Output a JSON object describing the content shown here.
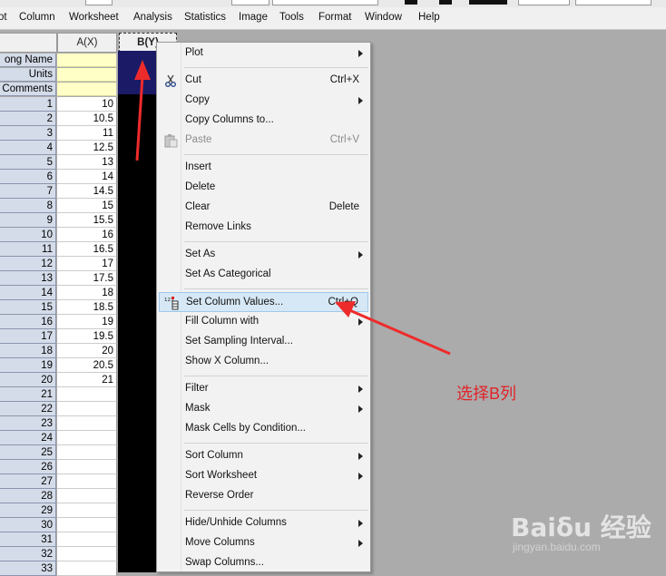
{
  "menubar": {
    "items": [
      "ot",
      "Column",
      "Worksheet",
      "Analysis",
      "Statistics",
      "Image",
      "Tools",
      "Format",
      "Window",
      "Help"
    ]
  },
  "sheet": {
    "col_a_header": "A(X)",
    "col_b_header": "B(Y)",
    "meta_labels": [
      "ong Name",
      "Units",
      "Comments"
    ],
    "rows": [
      {
        "n": "1",
        "a": "10"
      },
      {
        "n": "2",
        "a": "10.5"
      },
      {
        "n": "3",
        "a": "11"
      },
      {
        "n": "4",
        "a": "12.5"
      },
      {
        "n": "5",
        "a": "13"
      },
      {
        "n": "6",
        "a": "14"
      },
      {
        "n": "7",
        "a": "14.5"
      },
      {
        "n": "8",
        "a": "15"
      },
      {
        "n": "9",
        "a": "15.5"
      },
      {
        "n": "10",
        "a": "16"
      },
      {
        "n": "11",
        "a": "16.5"
      },
      {
        "n": "12",
        "a": "17"
      },
      {
        "n": "13",
        "a": "17.5"
      },
      {
        "n": "14",
        "a": "18"
      },
      {
        "n": "15",
        "a": "18.5"
      },
      {
        "n": "16",
        "a": "19"
      },
      {
        "n": "17",
        "a": "19.5"
      },
      {
        "n": "18",
        "a": "20"
      },
      {
        "n": "19",
        "a": "20.5"
      },
      {
        "n": "20",
        "a": "21"
      },
      {
        "n": "21",
        "a": ""
      },
      {
        "n": "22",
        "a": ""
      },
      {
        "n": "23",
        "a": ""
      },
      {
        "n": "24",
        "a": ""
      },
      {
        "n": "25",
        "a": ""
      },
      {
        "n": "26",
        "a": ""
      },
      {
        "n": "27",
        "a": ""
      },
      {
        "n": "28",
        "a": ""
      },
      {
        "n": "29",
        "a": ""
      },
      {
        "n": "30",
        "a": ""
      },
      {
        "n": "31",
        "a": ""
      },
      {
        "n": "32",
        "a": ""
      },
      {
        "n": "33",
        "a": ""
      }
    ]
  },
  "context_menu": {
    "groups": [
      [
        {
          "label": "Plot",
          "shortcut": "",
          "submenu": true
        }
      ],
      [
        {
          "label": "Cut",
          "shortcut": "Ctrl+X",
          "icon": "scissors-icon"
        },
        {
          "label": "Copy",
          "shortcut": "",
          "submenu": true
        },
        {
          "label": "Copy Columns to...",
          "shortcut": ""
        },
        {
          "label": "Paste",
          "shortcut": "Ctrl+V",
          "icon": "clipboard-icon",
          "disabled": true
        }
      ],
      [
        {
          "label": "Insert",
          "shortcut": ""
        },
        {
          "label": "Delete",
          "shortcut": ""
        },
        {
          "label": "Clear",
          "shortcut": "Delete"
        },
        {
          "label": "Remove Links",
          "shortcut": ""
        }
      ],
      [
        {
          "label": "Set As",
          "shortcut": "",
          "submenu": true
        },
        {
          "label": "Set As Categorical",
          "shortcut": ""
        }
      ],
      [
        {
          "label": "Set Column Values...",
          "shortcut": "Ctrl+Q",
          "icon": "set-values-icon",
          "highlighted": true
        },
        {
          "label": "Fill Column with",
          "shortcut": "",
          "submenu": true
        },
        {
          "label": "Set Sampling Interval...",
          "shortcut": ""
        },
        {
          "label": "Show X Column...",
          "shortcut": ""
        }
      ],
      [
        {
          "label": "Filter",
          "shortcut": "",
          "submenu": true
        },
        {
          "label": "Mask",
          "shortcut": "",
          "submenu": true
        },
        {
          "label": "Mask Cells by Condition...",
          "shortcut": ""
        }
      ],
      [
        {
          "label": "Sort Column",
          "shortcut": "",
          "submenu": true
        },
        {
          "label": "Sort Worksheet",
          "shortcut": "",
          "submenu": true
        },
        {
          "label": "Reverse Order",
          "shortcut": ""
        }
      ],
      [
        {
          "label": "Hide/Unhide Columns",
          "shortcut": "",
          "submenu": true
        },
        {
          "label": "Move Columns",
          "shortcut": "",
          "submenu": true
        },
        {
          "label": "Swap Columns...",
          "shortcut": ""
        }
      ]
    ]
  },
  "annotation": {
    "text": "选择B列",
    "color": "#e0242a"
  },
  "watermark": {
    "logo": "Baiδu 经验",
    "url": "jingyan.baidu.com"
  },
  "colors": {
    "selection": "#000000",
    "highlight": "#d6e8f6",
    "meta_yellow": "#ffffc6",
    "row_header": "#d5dce9"
  }
}
